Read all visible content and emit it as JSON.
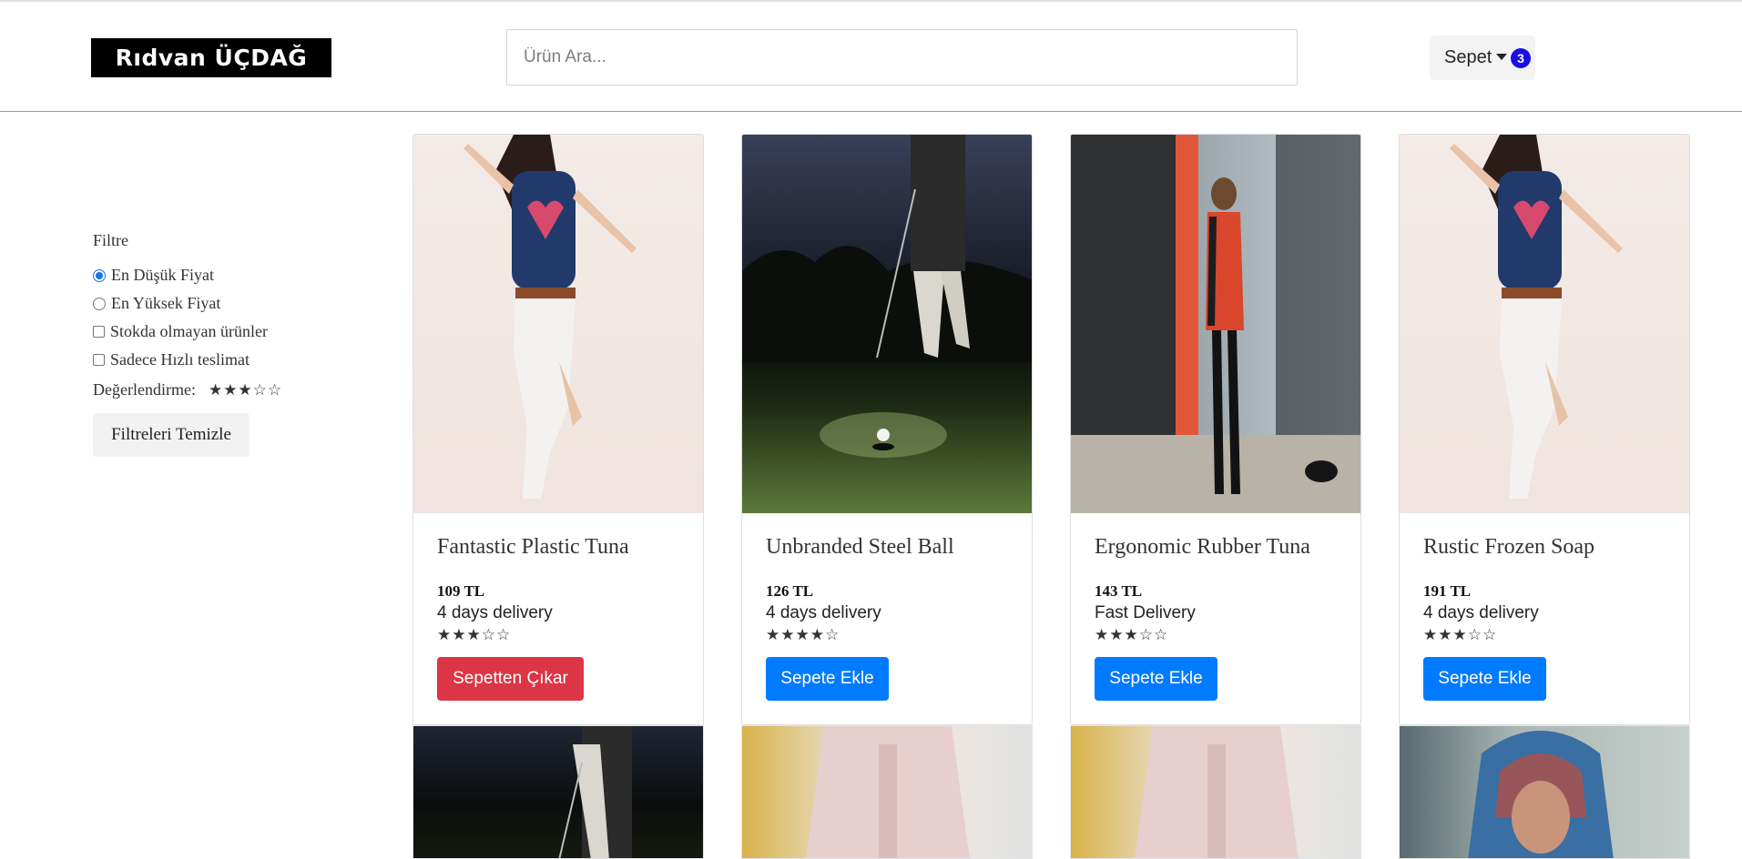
{
  "header": {
    "logo_text": "Rıdvan ÜÇDAĞ",
    "search_placeholder": "Ürün Ara...",
    "cart_label": "Sepet",
    "cart_count": "3"
  },
  "filters": {
    "title": "Filtre",
    "options": [
      {
        "label": "En Düşük Fiyat",
        "type": "radio",
        "checked": true
      },
      {
        "label": "En Yüksek Fiyat",
        "type": "radio",
        "checked": false
      },
      {
        "label": "Stokda olmayan ürünler",
        "type": "checkbox",
        "checked": false
      },
      {
        "label": "Sadece Hızlı teslimat",
        "type": "checkbox",
        "checked": false
      }
    ],
    "rating_label": "Değerlendirme:",
    "rating_stars": "★★★☆☆",
    "clear_label": "Filtreleri Temizle"
  },
  "products": [
    {
      "name": "Fantastic Plastic Tuna",
      "price": "109 TL",
      "delivery": "4 days delivery",
      "stars": "★★★☆☆",
      "button": "Sepetten Çıkar",
      "in_cart": true
    },
    {
      "name": "Unbranded Steel Ball",
      "price": "126 TL",
      "delivery": "4 days delivery",
      "stars": "★★★★☆",
      "button": "Sepete Ekle",
      "in_cart": false
    },
    {
      "name": "Ergonomic Rubber Tuna",
      "price": "143 TL",
      "delivery": "Fast Delivery",
      "stars": "★★★☆☆",
      "button": "Sepete Ekle",
      "in_cart": false
    },
    {
      "name": "Rustic Frozen Soap",
      "price": "191 TL",
      "delivery": "4 days delivery",
      "stars": "★★★☆☆",
      "button": "Sepete Ekle",
      "in_cart": false
    }
  ],
  "colors": {
    "remove_button": "#dc3545",
    "add_button": "#007bff",
    "badge": "#1a0ee6"
  }
}
